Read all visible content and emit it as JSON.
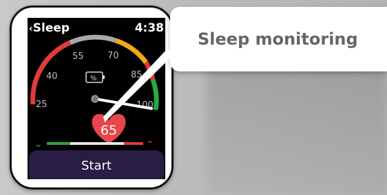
{
  "header": {
    "back_icon": "chevron-left-icon",
    "title": "Sleep",
    "time": "4:38"
  },
  "gauge": {
    "ticks": [
      "25",
      "40",
      "55",
      "70",
      "85",
      "100"
    ],
    "unit": "%",
    "value": 65,
    "colors": {
      "low": "#e03b3b",
      "mid": "#f0a81c",
      "high": "#27a843"
    }
  },
  "range_bar": {
    "left_icon": "chevron-down-icon",
    "right_icon": "chevron-up-icon"
  },
  "start_label": "Start",
  "callout": {
    "text": "Sleep monitoring"
  }
}
